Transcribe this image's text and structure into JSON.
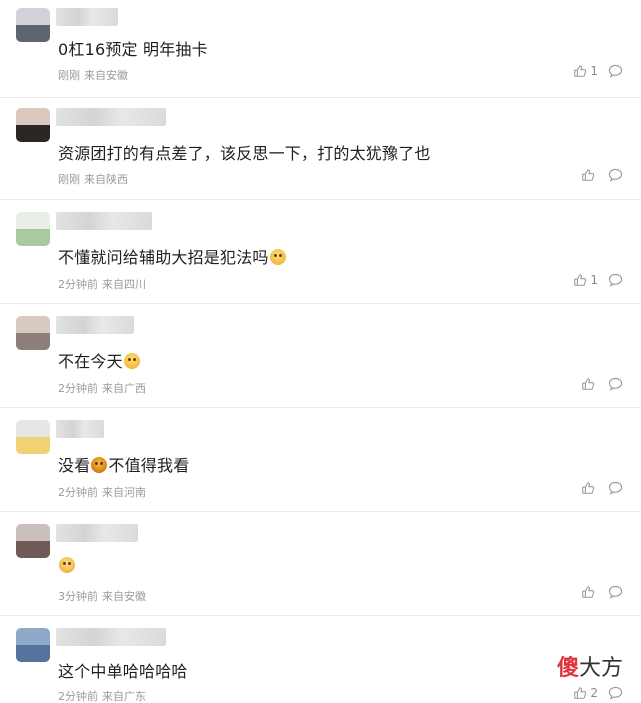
{
  "comments": [
    {
      "text": "0杠16预定 明年抽卡",
      "emoji": "",
      "text_after": "",
      "time": "刚刚",
      "location": "来自安徽",
      "likes": "1",
      "avatar_colors": [
        "#cfd3d8",
        "#5d6670"
      ]
    },
    {
      "text": "资源团打的有点差了，该反思一下，打的太犹豫了也",
      "emoji": "",
      "text_after": "",
      "time": "刚刚",
      "location": "来自陕西",
      "likes": "",
      "avatar_colors": [
        "#d8c8bf",
        "#2b2624"
      ]
    },
    {
      "text": "不懂就问给辅助大招是犯法吗",
      "emoji": "emoji-smirk",
      "text_after": "",
      "time": "2分钟前",
      "location": "来自四川",
      "likes": "1",
      "avatar_colors": [
        "#e9eee6",
        "#a9c9a0"
      ]
    },
    {
      "text": "不在今天",
      "emoji": "emoji-sad",
      "text_after": "",
      "time": "2分钟前",
      "location": "来自广西",
      "likes": "",
      "avatar_colors": [
        "#d9c9c3",
        "#8d7f7a"
      ]
    },
    {
      "text": "没看",
      "emoji": "emoji-tears",
      "text_after": "不值得我看",
      "time": "2分钟前",
      "location": "来自河南",
      "likes": "",
      "avatar_colors": [
        "#e6e6e6",
        "#f0d274"
      ]
    },
    {
      "text": "",
      "emoji": "emoji-cry",
      "text_after": "",
      "time": "3分钟前",
      "location": "来自安徽",
      "likes": "",
      "avatar_colors": [
        "#c9bfbd",
        "#6f5a55"
      ]
    },
    {
      "text": "这个中单哈哈哈哈",
      "emoji": "",
      "text_after": "",
      "time": "2分钟前",
      "location": "来自广东",
      "likes": "2",
      "avatar_colors": [
        "#8fa9c9",
        "#54749e"
      ]
    }
  ],
  "watermark": {
    "part1": "傻",
    "part2": "大方"
  }
}
